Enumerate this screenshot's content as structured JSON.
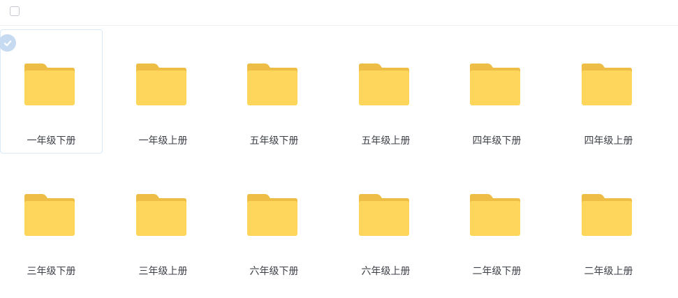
{
  "toolbar": {
    "select_all_icon": "checkbox-icon"
  },
  "folders": [
    {
      "name": "一年级下册",
      "selected": true
    },
    {
      "name": "一年级上册",
      "selected": false
    },
    {
      "name": "五年级下册",
      "selected": false
    },
    {
      "name": "五年级上册",
      "selected": false
    },
    {
      "name": "四年级下册",
      "selected": false
    },
    {
      "name": "四年级上册",
      "selected": false
    },
    {
      "name": "三年级下册",
      "selected": false
    },
    {
      "name": "三年级上册",
      "selected": false
    },
    {
      "name": "六年级下册",
      "selected": false
    },
    {
      "name": "六年级上册",
      "selected": false
    },
    {
      "name": "二年级下册",
      "selected": false
    },
    {
      "name": "二年级上册",
      "selected": false
    }
  ],
  "colors": {
    "folder_front": "#FFD65C",
    "folder_back": "#EEBD45",
    "selected_check": "#C6DBF1",
    "selected_border": "#D9E9F7"
  }
}
